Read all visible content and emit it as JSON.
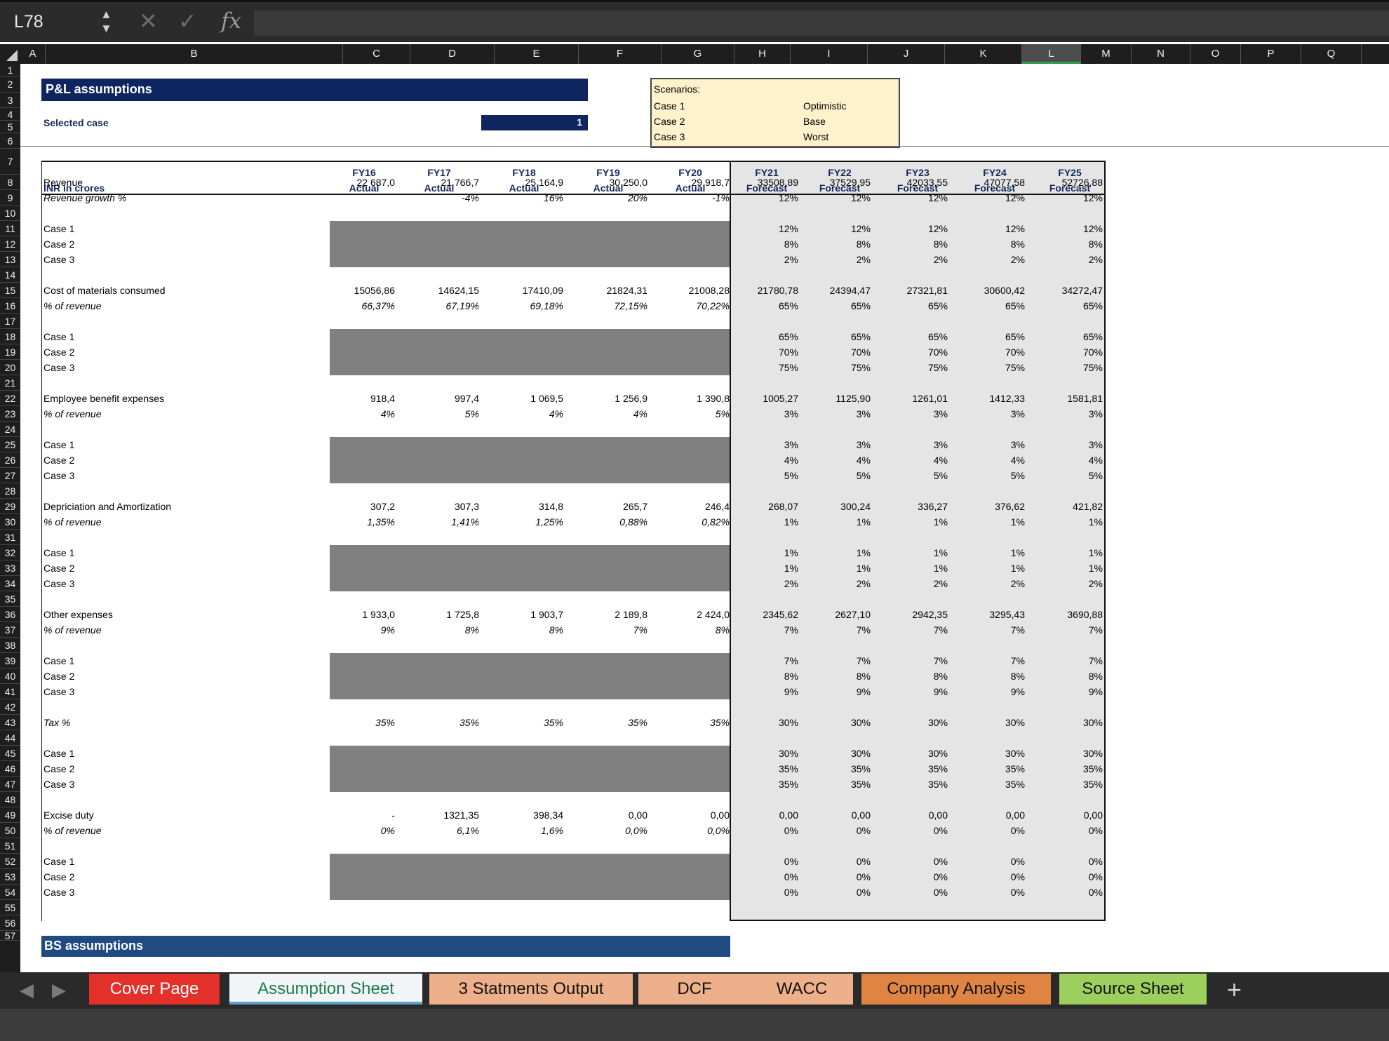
{
  "formula_bar": {
    "cell_ref": "L78",
    "cancel_icon": "✕",
    "confirm_icon": "✓",
    "fx_label": "fx",
    "formula": ""
  },
  "columns": [
    "A",
    "B",
    "C",
    "D",
    "E",
    "F",
    "G",
    "H",
    "I",
    "J",
    "K",
    "L",
    "M",
    "N",
    "O",
    "P",
    "Q"
  ],
  "selected_column": "L",
  "rows": [
    1,
    2,
    3,
    4,
    5,
    6,
    7,
    8,
    9,
    10,
    11,
    12,
    13,
    14,
    15,
    16,
    17,
    18,
    19,
    20,
    21,
    22,
    23,
    24,
    25,
    26,
    27,
    28,
    29,
    30,
    31,
    32,
    33,
    34,
    35,
    36,
    37,
    38,
    39,
    40,
    41,
    42,
    43,
    44,
    45,
    46,
    47,
    48,
    49,
    50,
    51,
    52,
    53,
    54,
    55,
    56,
    57
  ],
  "header": {
    "title": "P&L assumptions",
    "selected_case_label": "Selected case",
    "selected_case_value": "1",
    "bs_title": "BS assumptions"
  },
  "scenarios": {
    "title": "Scenarios:",
    "rows": [
      [
        "Case 1",
        "Optimistic"
      ],
      [
        "Case 2",
        "Base"
      ],
      [
        "Case 3",
        "Worst"
      ]
    ]
  },
  "table": {
    "unit_label": "INR in crores",
    "years": [
      "FY16",
      "FY17",
      "FY18",
      "FY19",
      "FY20",
      "FY21",
      "FY22",
      "FY23",
      "FY24",
      "FY25"
    ],
    "types": [
      "Actual",
      "Actual",
      "Actual",
      "Actual",
      "Actual",
      "Forecast",
      "Forecast",
      "Forecast",
      "Forecast",
      "Forecast"
    ],
    "rows": [
      {
        "label": "Revenue",
        "values": [
          "22 687,0",
          "21 766,7",
          "25 164,9",
          "30 250,0",
          "29 918,7",
          "33508,89",
          "37529,95",
          "42033,55",
          "47077,58",
          "52726,88"
        ]
      },
      {
        "label": "Revenue growth %",
        "italic": true,
        "values": [
          "",
          "-4%",
          "16%",
          "20%",
          "-1%",
          "12%",
          "12%",
          "12%",
          "12%",
          "12%"
        ]
      },
      {
        "label": "Case 1",
        "case": true,
        "values": [
          "12%",
          "12%",
          "12%",
          "12%",
          "12%"
        ]
      },
      {
        "label": "Case 2",
        "case": true,
        "values": [
          "8%",
          "8%",
          "8%",
          "8%",
          "8%"
        ]
      },
      {
        "label": "Case 3",
        "case": true,
        "values": [
          "2%",
          "2%",
          "2%",
          "2%",
          "2%"
        ]
      },
      {
        "label": "Cost of materials consumed",
        "values": [
          "15056,86",
          "14624,15",
          "17410,09",
          "21824,31",
          "21008,28",
          "21780,78",
          "24394,47",
          "27321,81",
          "30600,42",
          "34272,47"
        ]
      },
      {
        "label": "% of revenue",
        "italic": true,
        "values": [
          "66,37%",
          "67,19%",
          "69,18%",
          "72,15%",
          "70,22%",
          "65%",
          "65%",
          "65%",
          "65%",
          "65%"
        ]
      },
      {
        "label": "Case 1",
        "case": true,
        "values": [
          "65%",
          "65%",
          "65%",
          "65%",
          "65%"
        ]
      },
      {
        "label": "Case 2",
        "case": true,
        "values": [
          "70%",
          "70%",
          "70%",
          "70%",
          "70%"
        ]
      },
      {
        "label": "Case 3",
        "case": true,
        "values": [
          "75%",
          "75%",
          "75%",
          "75%",
          "75%"
        ]
      },
      {
        "label": "Employee benefit expenses",
        "values": [
          "918,4",
          "997,4",
          "1 069,5",
          "1 256,9",
          "1 390,8",
          "1005,27",
          "1125,90",
          "1261,01",
          "1412,33",
          "1581,81"
        ]
      },
      {
        "label": "% of revenue",
        "italic": true,
        "values": [
          "4%",
          "5%",
          "4%",
          "4%",
          "5%",
          "3%",
          "3%",
          "3%",
          "3%",
          "3%"
        ]
      },
      {
        "label": "Case 1",
        "case": true,
        "values": [
          "3%",
          "3%",
          "3%",
          "3%",
          "3%"
        ]
      },
      {
        "label": "Case 2",
        "case": true,
        "values": [
          "4%",
          "4%",
          "4%",
          "4%",
          "4%"
        ]
      },
      {
        "label": "Case 3",
        "case": true,
        "values": [
          "5%",
          "5%",
          "5%",
          "5%",
          "5%"
        ]
      },
      {
        "label": "Depriciation and Amortization",
        "values": [
          "307,2",
          "307,3",
          "314,8",
          "265,7",
          "246,4",
          "268,07",
          "300,24",
          "336,27",
          "376,62",
          "421,82"
        ]
      },
      {
        "label": "% of revenue",
        "italic": true,
        "values": [
          "1,35%",
          "1,41%",
          "1,25%",
          "0,88%",
          "0,82%",
          "1%",
          "1%",
          "1%",
          "1%",
          "1%"
        ]
      },
      {
        "label": "Case 1",
        "case": true,
        "values": [
          "1%",
          "1%",
          "1%",
          "1%",
          "1%"
        ]
      },
      {
        "label": "Case 2",
        "case": true,
        "values": [
          "1%",
          "1%",
          "1%",
          "1%",
          "1%"
        ]
      },
      {
        "label": "Case 3",
        "case": true,
        "values": [
          "2%",
          "2%",
          "2%",
          "2%",
          "2%"
        ]
      },
      {
        "label": "Other expenses",
        "values": [
          "1 933,0",
          "1 725,8",
          "1 903,7",
          "2 189,8",
          "2 424,0",
          "2345,62",
          "2627,10",
          "2942,35",
          "3295,43",
          "3690,88"
        ]
      },
      {
        "label": "% of revenue",
        "italic": true,
        "values": [
          "9%",
          "8%",
          "8%",
          "7%",
          "8%",
          "7%",
          "7%",
          "7%",
          "7%",
          "7%"
        ]
      },
      {
        "label": "Case 1",
        "case": true,
        "values": [
          "7%",
          "7%",
          "7%",
          "7%",
          "7%"
        ]
      },
      {
        "label": "Case 2",
        "case": true,
        "values": [
          "8%",
          "8%",
          "8%",
          "8%",
          "8%"
        ]
      },
      {
        "label": "Case 3",
        "case": true,
        "values": [
          "9%",
          "9%",
          "9%",
          "9%",
          "9%"
        ]
      },
      {
        "label": "Tax %",
        "italic": true,
        "values": [
          "35%",
          "35%",
          "35%",
          "35%",
          "35%",
          "30%",
          "30%",
          "30%",
          "30%",
          "30%"
        ]
      },
      {
        "label": "Case 1",
        "case": true,
        "values": [
          "30%",
          "30%",
          "30%",
          "30%",
          "30%"
        ]
      },
      {
        "label": "Case 2",
        "case": true,
        "values": [
          "35%",
          "35%",
          "35%",
          "35%",
          "35%"
        ]
      },
      {
        "label": "Case 3",
        "case": true,
        "values": [
          "35%",
          "35%",
          "35%",
          "35%",
          "35%"
        ]
      },
      {
        "label": "Excise duty",
        "values": [
          "-",
          "1321,35",
          "398,34",
          "0,00",
          "0,00",
          "0,00",
          "0,00",
          "0,00",
          "0,00",
          "0,00"
        ]
      },
      {
        "label": "% of revenue",
        "italic": true,
        "values": [
          "0%",
          "6,1%",
          "1,6%",
          "0,0%",
          "0,0%",
          "0%",
          "0%",
          "0%",
          "0%",
          "0%"
        ]
      },
      {
        "label": "Case 1",
        "case": true,
        "values": [
          "0%",
          "0%",
          "0%",
          "0%",
          "0%"
        ]
      },
      {
        "label": "Case 2",
        "case": true,
        "values": [
          "0%",
          "0%",
          "0%",
          "0%",
          "0%"
        ]
      },
      {
        "label": "Case 3",
        "case": true,
        "values": [
          "0%",
          "0%",
          "0%",
          "0%",
          "0%"
        ]
      }
    ]
  },
  "sheet_tabs": [
    {
      "label": "Cover Page",
      "color": "#e3312a",
      "text": "#ffffff"
    },
    {
      "label": "Assumption Sheet",
      "color": "#f1f5f8",
      "text": "#1e7a4b",
      "active": true
    },
    {
      "label": "3 Statments Output",
      "color": "#edb08a",
      "text": "#111111"
    },
    {
      "label": "DCF",
      "color": "#edb08a",
      "text": "#111111"
    },
    {
      "label": "WACC",
      "color": "#edb08a",
      "text": "#111111"
    },
    {
      "label": "Company Analysis",
      "color": "#e08443",
      "text": "#111111"
    },
    {
      "label": "Source Sheet",
      "color": "#9ccf5e",
      "text": "#111111"
    }
  ],
  "add_sheet_icon": "+"
}
